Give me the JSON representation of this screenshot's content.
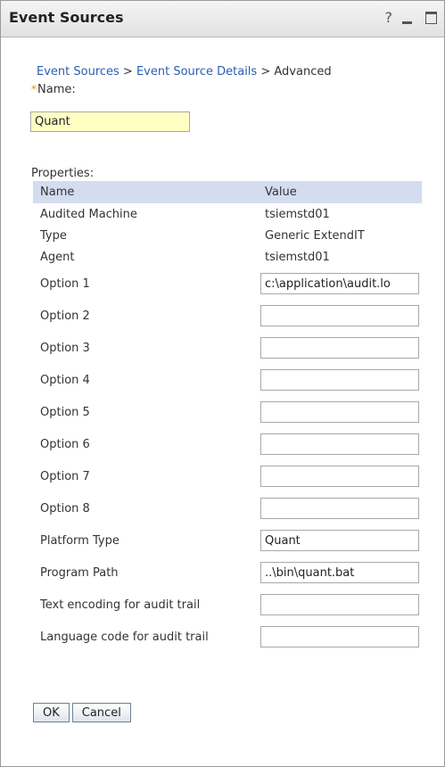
{
  "window": {
    "title": "Event Sources",
    "help_glyph": "?"
  },
  "breadcrumb": {
    "item1": "Event Sources",
    "sep1": " > ",
    "item2": "Event Source Details",
    "sep2": " > ",
    "current": "Advanced"
  },
  "name_field": {
    "required_mark": "*",
    "label": "Name:",
    "value": "Quant"
  },
  "properties": {
    "label": "Properties:",
    "columns": [
      "Name",
      "Value"
    ],
    "static_rows": [
      {
        "name": "Audited Machine",
        "value": "tsiemstd01"
      },
      {
        "name": "Type",
        "value": "Generic ExtendIT"
      },
      {
        "name": "Agent",
        "value": "tsiemstd01"
      }
    ],
    "input_rows": [
      {
        "name": "Option 1",
        "value": "c:\\application\\audit.lo"
      },
      {
        "name": "Option 2",
        "value": ""
      },
      {
        "name": "Option 3",
        "value": ""
      },
      {
        "name": "Option 4",
        "value": ""
      },
      {
        "name": "Option 5",
        "value": ""
      },
      {
        "name": "Option 6",
        "value": ""
      },
      {
        "name": "Option 7",
        "value": ""
      },
      {
        "name": "Option 8",
        "value": ""
      },
      {
        "name": "Platform Type",
        "value": "Quant"
      },
      {
        "name": "Program Path",
        "value": "..\\bin\\quant.bat"
      },
      {
        "name": "Text encoding for audit trail",
        "value": ""
      },
      {
        "name": "Language code for audit trail",
        "value": ""
      }
    ]
  },
  "buttons": {
    "ok": "OK",
    "cancel": "Cancel"
  },
  "colors": {
    "link": "#2a5db0",
    "header_bg": "#d4dcf0",
    "name_input_bg": "#ffffc4"
  }
}
